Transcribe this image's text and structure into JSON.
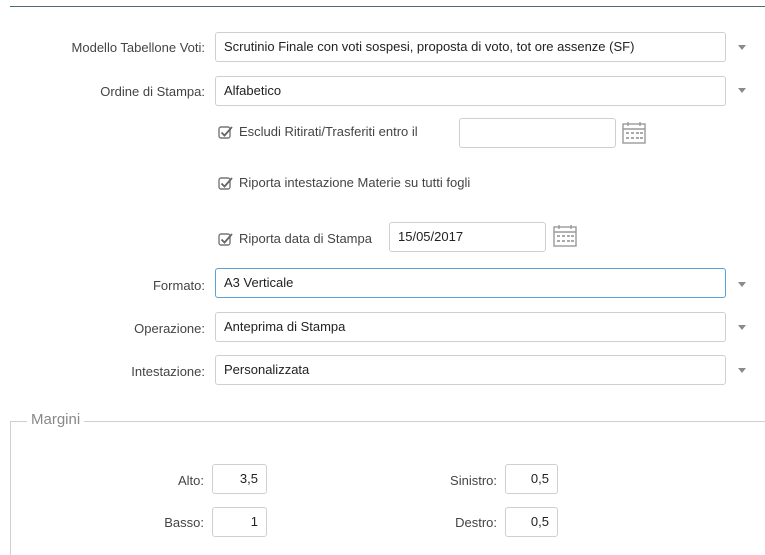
{
  "form": {
    "modello": {
      "label": "Modello Tabellone Voti:",
      "value": "Scrutinio Finale con voti sospesi, proposta di voto, tot ore assenze (SF)"
    },
    "ordine": {
      "label": "Ordine di Stampa:",
      "value": "Alfabetico"
    },
    "escludi": {
      "label": "Escludi Ritirati/Trasferiti entro il",
      "checked": true,
      "value": ""
    },
    "riporta_intestazione": {
      "label": "Riporta intestazione Materie su tutti fogli",
      "checked": true
    },
    "riporta_data": {
      "label": "Riporta data di Stampa",
      "checked": true,
      "value": "15/05/2017"
    },
    "formato": {
      "label": "Formato:",
      "value": "A3 Verticale"
    },
    "operazione": {
      "label": "Operazione:",
      "value": "Anteprima di Stampa"
    },
    "intestazione": {
      "label": "Intestazione:",
      "value": "Personalizzata"
    }
  },
  "margini": {
    "legend": "Margini",
    "alto": {
      "label": "Alto:",
      "value": "3,5"
    },
    "basso": {
      "label": "Basso:",
      "value": "1"
    },
    "sinistro": {
      "label": "Sinistro:",
      "value": "0,5"
    },
    "destro": {
      "label": "Destro:",
      "value": "0,5"
    }
  },
  "icons": {
    "checkbox": "checkbox-checked-icon",
    "calendar": "calendar-icon",
    "dropdown": "chevron-down-icon"
  },
  "colors": {
    "focus_border": "#5aa0d8",
    "border": "#cfcfcf",
    "top_rule": "#4a6b70"
  }
}
